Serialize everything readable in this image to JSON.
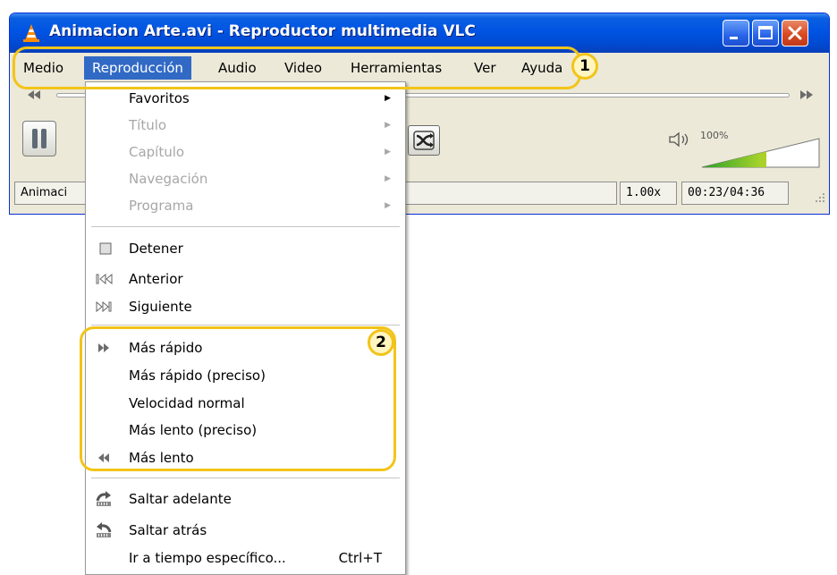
{
  "window": {
    "title": "Animacion Arte.avi - Reproductor multimedia VLC"
  },
  "menubar": {
    "items": [
      {
        "label": "Medio"
      },
      {
        "label": "Reproducción",
        "active": true
      },
      {
        "label": "Audio"
      },
      {
        "label": "Video"
      },
      {
        "label": "Herramientas"
      },
      {
        "label": "Ver"
      },
      {
        "label": "Ayuda"
      }
    ]
  },
  "player": {
    "volume_label": "100%",
    "volume_level": 0.55,
    "status_filename": "Animaci",
    "speed": "1.00x",
    "time": "00:23/04:36"
  },
  "dropdown": {
    "items": [
      {
        "label": "Favoritos",
        "enabled": true,
        "submenu": true,
        "icon": ""
      },
      {
        "label": "Título",
        "enabled": false,
        "submenu": true,
        "icon": ""
      },
      {
        "label": "Capítulo",
        "enabled": false,
        "submenu": true,
        "icon": ""
      },
      {
        "label": "Navegación",
        "enabled": false,
        "submenu": true,
        "icon": ""
      },
      {
        "label": "Programa",
        "enabled": false,
        "submenu": true,
        "icon": ""
      },
      {
        "label": "Detener",
        "enabled": true,
        "icon": "stop-icon"
      },
      {
        "label": "Anterior",
        "enabled": true,
        "icon": "previous-icon"
      },
      {
        "label": "Siguiente",
        "enabled": true,
        "icon": "next-icon"
      },
      {
        "label": "Más rápido",
        "enabled": true,
        "icon": "fast-forward-icon"
      },
      {
        "label": "Más rápido (preciso)",
        "enabled": true,
        "icon": ""
      },
      {
        "label": "Velocidad normal",
        "enabled": true,
        "icon": ""
      },
      {
        "label": "Más lento (preciso)",
        "enabled": true,
        "icon": ""
      },
      {
        "label": "Más lento",
        "enabled": true,
        "icon": "rewind-icon"
      },
      {
        "label": "Saltar adelante",
        "enabled": true,
        "icon": "jump-forward-icon"
      },
      {
        "label": "Saltar atrás",
        "enabled": true,
        "icon": "jump-backward-icon"
      },
      {
        "label": "Ir a tiempo específico...",
        "enabled": true,
        "shortcut": "Ctrl+T",
        "icon": ""
      }
    ]
  },
  "annotations": {
    "badge_1": "1",
    "badge_2": "2"
  },
  "colors": {
    "titlebar": "#0054e3",
    "menu_highlight": "#316ac5",
    "annotation": "#f2c419",
    "disabled_text": "#a7a7a7"
  }
}
